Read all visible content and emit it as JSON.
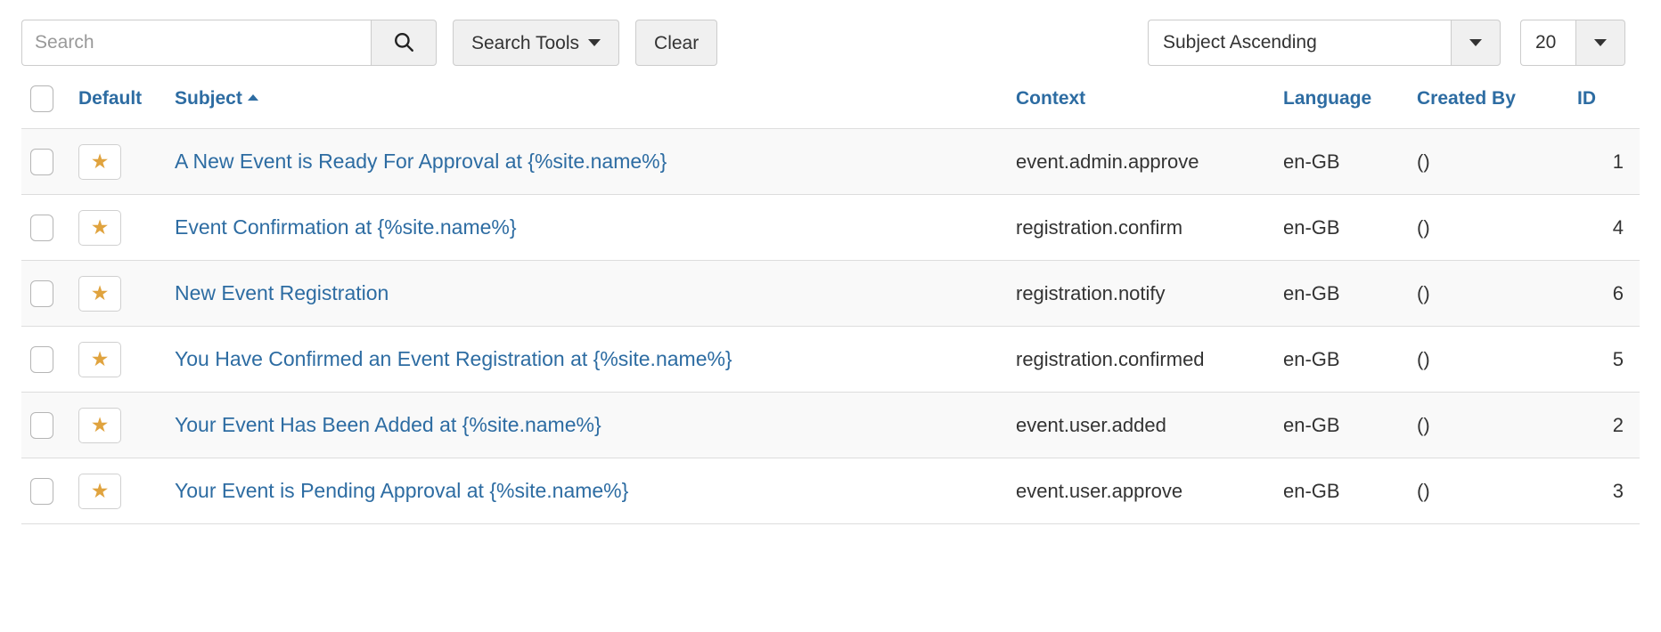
{
  "toolbar": {
    "search_placeholder": "Search",
    "search_value": "",
    "search_button_icon": "search-icon",
    "search_tools_label": "Search Tools",
    "clear_label": "Clear",
    "sort_selected": "Subject Ascending",
    "limit_selected": "20"
  },
  "table": {
    "headers": {
      "select_all": "",
      "default": "Default",
      "subject": "Subject",
      "context": "Context",
      "language": "Language",
      "created_by": "Created By",
      "id": "ID"
    },
    "sort": {
      "column": "Subject",
      "direction": "ascending"
    },
    "rows": [
      {
        "checked": false,
        "default_star": "★",
        "subject": "A New Event is Ready For Approval at {%site.name%}",
        "context": "event.admin.approve",
        "language": "en-GB",
        "created_by": "()",
        "id": "1"
      },
      {
        "checked": false,
        "default_star": "★",
        "subject": "Event Confirmation at {%site.name%}",
        "context": "registration.confirm",
        "language": "en-GB",
        "created_by": "()",
        "id": "4"
      },
      {
        "checked": false,
        "default_star": "★",
        "subject": "New Event Registration",
        "context": "registration.notify",
        "language": "en-GB",
        "created_by": "()",
        "id": "6"
      },
      {
        "checked": false,
        "default_star": "★",
        "subject": "You Have Confirmed an Event Registration at {%site.name%}",
        "context": "registration.confirmed",
        "language": "en-GB",
        "created_by": "()",
        "id": "5"
      },
      {
        "checked": false,
        "default_star": "★",
        "subject": "Your Event Has Been Added at {%site.name%}",
        "context": "event.user.added",
        "language": "en-GB",
        "created_by": "()",
        "id": "2"
      },
      {
        "checked": false,
        "default_star": "★",
        "subject": "Your Event is Pending Approval at {%site.name%}",
        "context": "event.user.approve",
        "language": "en-GB",
        "created_by": "()",
        "id": "3"
      }
    ]
  },
  "colors": {
    "link": "#2d6ca2",
    "star": "#e0a33e",
    "row_odd_bg": "#f9f9f9",
    "border": "#dddddd",
    "button_bg": "#f0f0f0"
  }
}
